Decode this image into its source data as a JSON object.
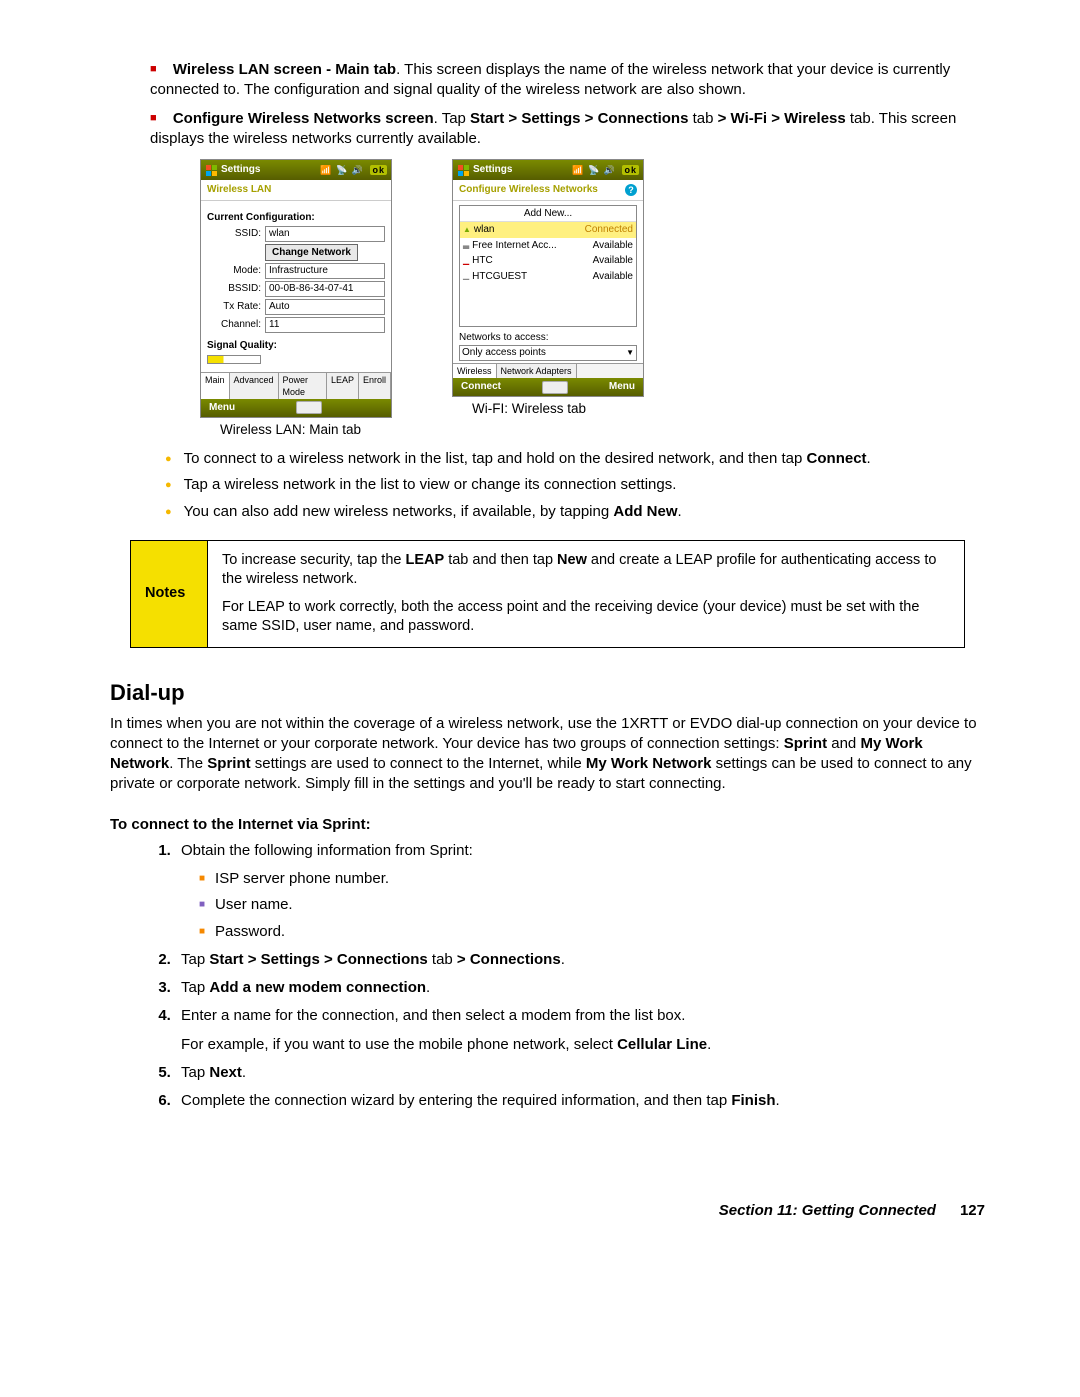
{
  "bullets": {
    "wlanMain": {
      "boldPrefix": "Wireless LAN screen - Main tab",
      "text": ". This screen displays the name of the wireless network that your device is currently connected to. The configuration and signal quality of the wireless network are also shown."
    },
    "configure": {
      "boldPrefix": "Configure Wireless Networks screen",
      "parts": [
        ". Tap ",
        "Start > Settings > Connections",
        " tab ",
        "> Wi-Fi > Wireless",
        " tab. This screen displays the wireless networks currently available."
      ]
    }
  },
  "phone1": {
    "title": "Settings",
    "section": "Wireless LAN",
    "currentConfig": "Current Configuration:",
    "ssidLabel": "SSID:",
    "ssidValue": "wlan",
    "changeNetwork": "Change Network",
    "modeLabel": "Mode:",
    "modeValue": "Infrastructure",
    "bssidLabel": "BSSID:",
    "bssidValue": "00-0B-86-34-07-41",
    "txRateLabel": "Tx Rate:",
    "txRateValue": "Auto",
    "channelLabel": "Channel:",
    "channelValue": "11",
    "signalQuality": "Signal Quality:",
    "tabs": [
      "Main",
      "Advanced",
      "Power Mode",
      "LEAP",
      "Enroll"
    ],
    "menu": "Menu",
    "caption": "Wireless LAN: Main tab"
  },
  "phone2": {
    "title": "Settings",
    "section": "Configure Wireless Networks",
    "addNew": "Add New...",
    "networks": [
      {
        "name": "wlan",
        "status": "Connected",
        "hl": true
      },
      {
        "name": "Free Internet Acc...",
        "status": "Available"
      },
      {
        "name": "HTC",
        "status": "Available"
      },
      {
        "name": "HTCGUEST",
        "status": "Available"
      }
    ],
    "accessLabel": "Networks to access:",
    "accessValue": "Only access points",
    "tabs": [
      "Wireless",
      "Network Adapters"
    ],
    "connect": "Connect",
    "menu": "Menu",
    "caption": "Wi-FI: Wireless tab"
  },
  "yellowBullets": [
    {
      "pre": "To connect to a wireless network in the list, tap and hold on the desired network, and then tap ",
      "bold": "Connect",
      "post": "."
    },
    {
      "pre": "Tap a wireless network in the list to view or change its connection settings.",
      "bold": "",
      "post": ""
    },
    {
      "pre": "You can also add new wireless networks, if available, by tapping ",
      "bold": "Add New",
      "post": "."
    }
  ],
  "notes": {
    "label": "Notes",
    "p1": {
      "pre": "To increase security, tap the ",
      "b1": "LEAP",
      "mid": " tab and then tap ",
      "b2": "New",
      "post": " and create a LEAP profile for authenticating access to the wireless network."
    },
    "p2": "For LEAP to work correctly, both the access point and the receiving device (your device) must be set with the same SSID, user name, and password."
  },
  "dialup": {
    "heading": "Dial-up",
    "intro": {
      "pre": "In times when you are not within the coverage of a wireless network, use the 1XRTT or EVDO dial-up connection on your device to connect to the Internet or your corporate network. Your device has two groups of connection settings: ",
      "b1": "Sprint",
      "mid1": " and ",
      "b2": "My Work Network",
      "mid2": ". The ",
      "b3": "Sprint",
      "mid3": " settings are used to connect to the Internet, while ",
      "b4": "My Work Network",
      "post": " settings can be used to connect to any private or corporate network. Simply fill in the settings and you'll be ready to start connecting."
    },
    "subhead": "To connect to the Internet via Sprint:",
    "step1": "Obtain the following information from Sprint:",
    "step1items": [
      "ISP server phone number.",
      "User name.",
      "Password."
    ],
    "step2": {
      "pre": "Tap ",
      "b1": "Start > Settings > Connections",
      "mid": " tab ",
      "b2": "> Connections",
      "post": "."
    },
    "step3": {
      "pre": "Tap ",
      "b": "Add a new modem connection",
      "post": "."
    },
    "step4": {
      "line": "Enter a name for the connection, and then select a modem from the list box.",
      "sub": {
        "pre": "For example, if you want to use the mobile phone network, select ",
        "b": "Cellular Line",
        "post": "."
      }
    },
    "step5": {
      "pre": "Tap ",
      "b": "Next",
      "post": "."
    },
    "step6": {
      "pre": "Complete the connection wizard by entering the required information, and then tap ",
      "b": "Finish",
      "post": "."
    }
  },
  "footer": {
    "section": "Section 11: Getting Connected",
    "page": "127"
  }
}
